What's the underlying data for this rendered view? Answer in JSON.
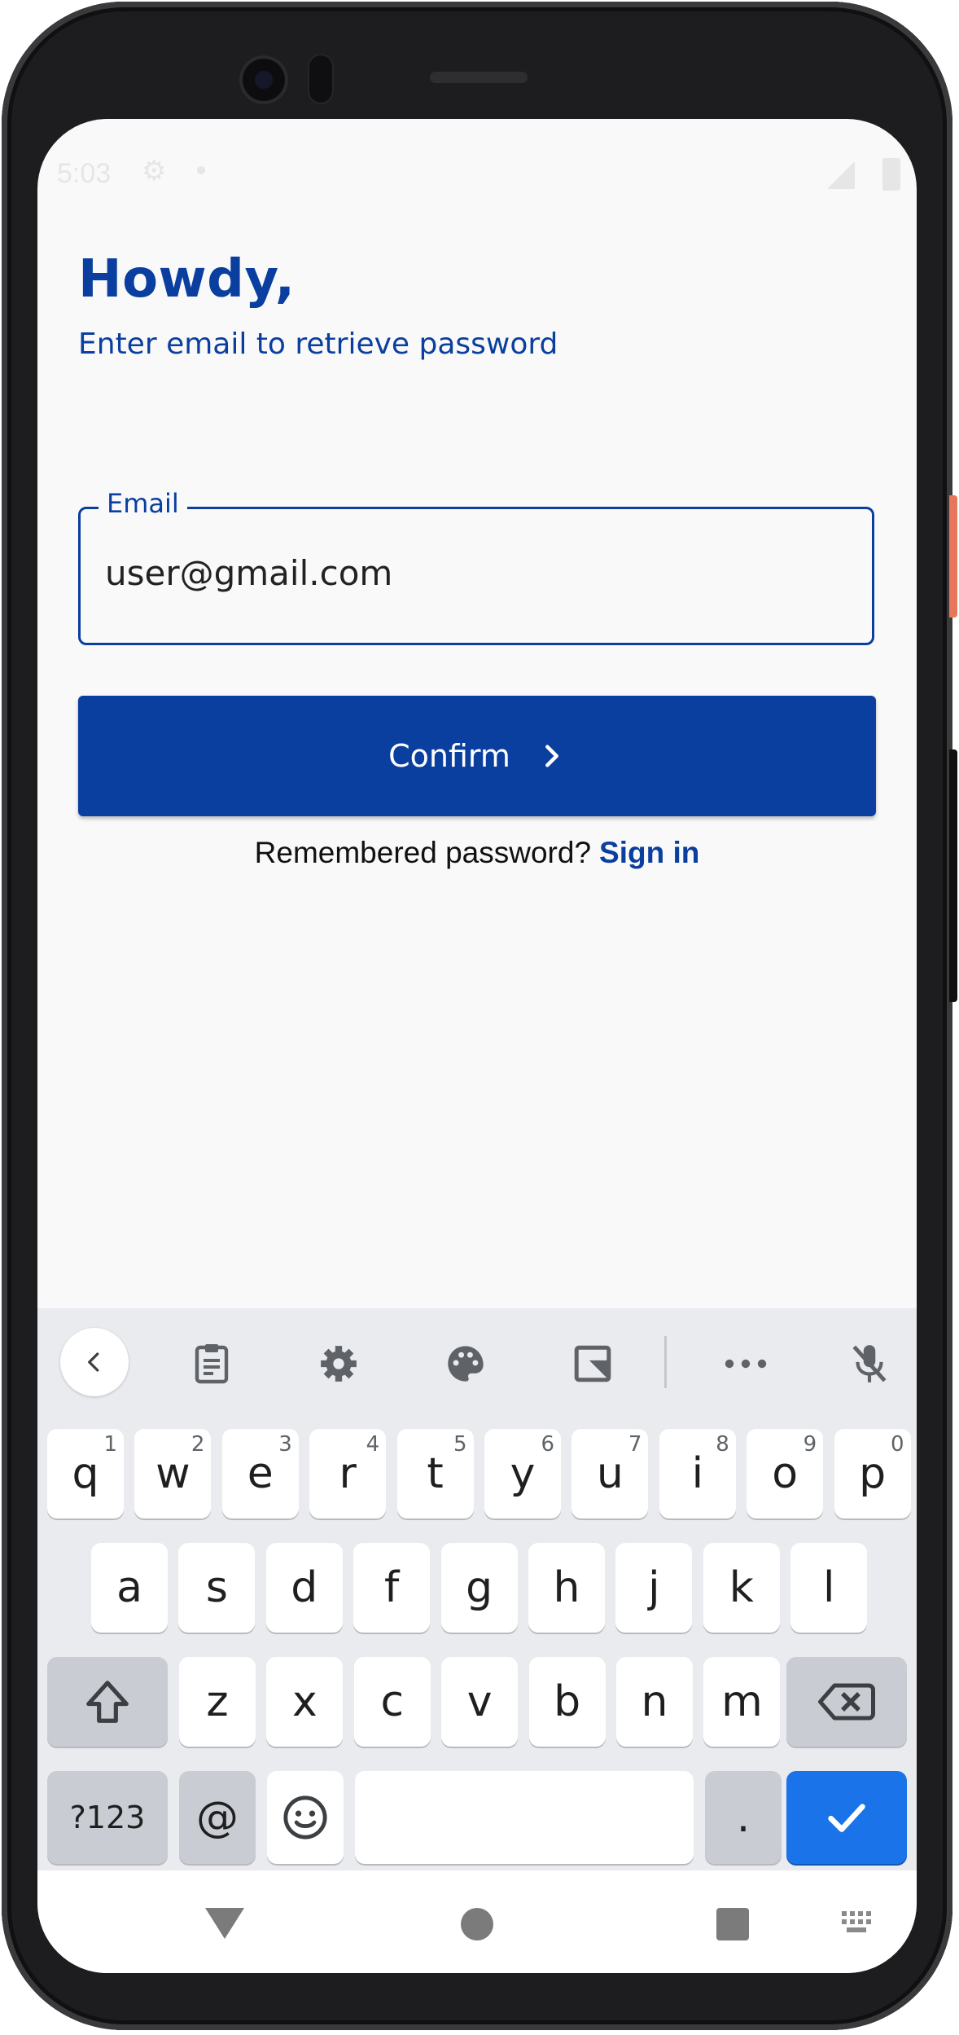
{
  "status_bar": {
    "time": "5:03"
  },
  "header": {
    "title": "Howdy,",
    "subtitle": "Enter email to retrieve password"
  },
  "email_field": {
    "label": "Email",
    "value": "user@gmail.com"
  },
  "confirm_button": {
    "label": "Confirm"
  },
  "footer": {
    "prompt": "Remembered password?",
    "link": "Sign in"
  },
  "colors": {
    "brand": "#0a3f9f",
    "background": "#f9f9f9",
    "keyboard_enter": "#1a73e8"
  },
  "keyboard": {
    "toolbar_icons": [
      "back-icon",
      "clipboard-icon",
      "gear-icon",
      "palette-icon",
      "screenshot-icon",
      "more-icon",
      "mic-off-icon"
    ],
    "row1": [
      {
        "k": "q",
        "h": "1"
      },
      {
        "k": "w",
        "h": "2"
      },
      {
        "k": "e",
        "h": "3"
      },
      {
        "k": "r",
        "h": "4"
      },
      {
        "k": "t",
        "h": "5"
      },
      {
        "k": "y",
        "h": "6"
      },
      {
        "k": "u",
        "h": "7"
      },
      {
        "k": "i",
        "h": "8"
      },
      {
        "k": "o",
        "h": "9"
      },
      {
        "k": "p",
        "h": "0"
      }
    ],
    "row2": [
      "a",
      "s",
      "d",
      "f",
      "g",
      "h",
      "j",
      "k",
      "l"
    ],
    "row3": [
      "z",
      "x",
      "c",
      "v",
      "b",
      "n",
      "m"
    ],
    "row4": {
      "symbols": "?123",
      "at": "@",
      "period": "."
    }
  }
}
